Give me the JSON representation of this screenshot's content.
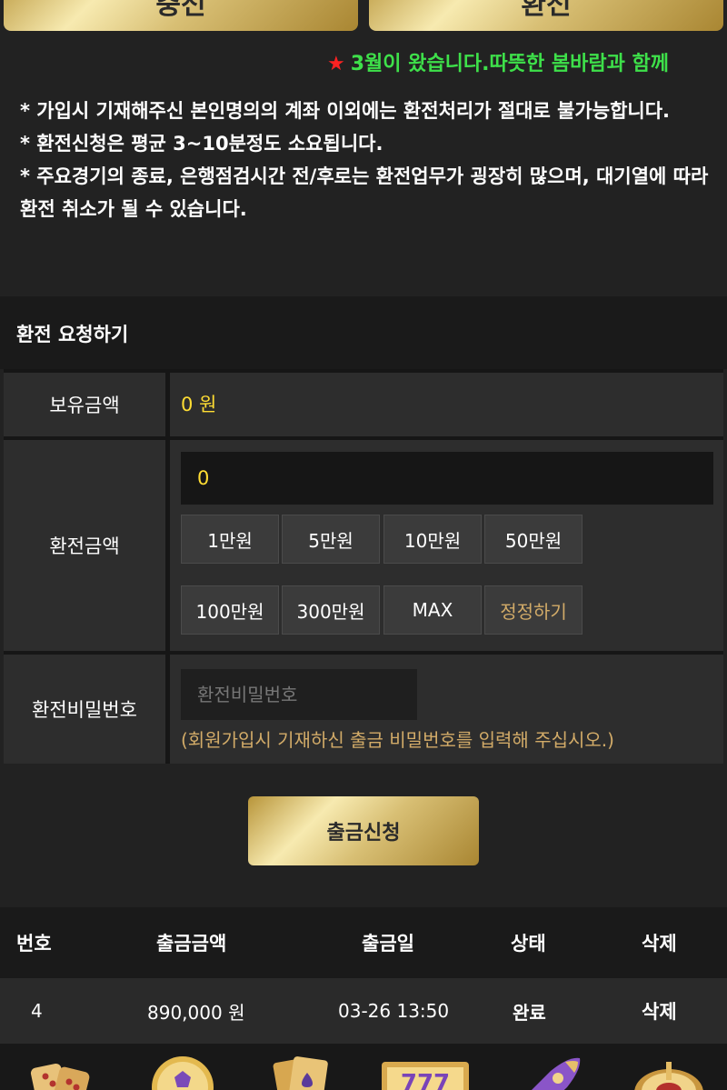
{
  "tabs": {
    "charge_label": "충전",
    "exchange_label": "환전"
  },
  "marquee": {
    "star": "★",
    "text": "3월이 왔습니다.따뜻한 봄바람과 함께"
  },
  "notice": {
    "lines": [
      "* 가입시 기재해주신 본인명의의 계좌 이외에는 환전처리가 절대로 불가능합니다.",
      "* 환전신청은 평균 3~10분정도 소요됩니다.",
      "* 주요경기의 종료, 은행점검시간 전/후로는 환전업무가 굉장히 많으며, 대기열에 따라 환전 취소가 될 수 있습니다."
    ]
  },
  "panel": {
    "title": "환전 요청하기"
  },
  "form": {
    "balance_label": "보유금액",
    "balance_value": "0 원",
    "amount_label": "환전금액",
    "amount_value": "0",
    "amount_buttons": [
      "1만원",
      "5만원",
      "10만원",
      "50만원",
      "100만원",
      "300만원",
      "MAX",
      "정정하기"
    ],
    "password_label": "환전비밀번호",
    "password_placeholder": "환전비밀번호",
    "password_help": "(회원가입시 기재하신 출금 비밀번호를 입력해 주십시오.)"
  },
  "submit_label": "출금신청",
  "table": {
    "headers": [
      "번호",
      "출금금액",
      "출금일",
      "상태",
      "삭제"
    ],
    "rows": [
      {
        "no": "4",
        "amount": "890,000 원",
        "date": "03-26 13:50",
        "status": "완료",
        "delete": "삭제"
      }
    ]
  },
  "games": [
    "dice-icon",
    "soccer-ball-icon",
    "playing-cards-icon",
    "slot-777-icon",
    "rocket-icon",
    "roulette-icon"
  ],
  "colors": {
    "gold": "#d8bf74",
    "highlight_yellow": "#ffdd33",
    "marquee_green": "#3ee04a",
    "star_red": "#ff2222"
  }
}
